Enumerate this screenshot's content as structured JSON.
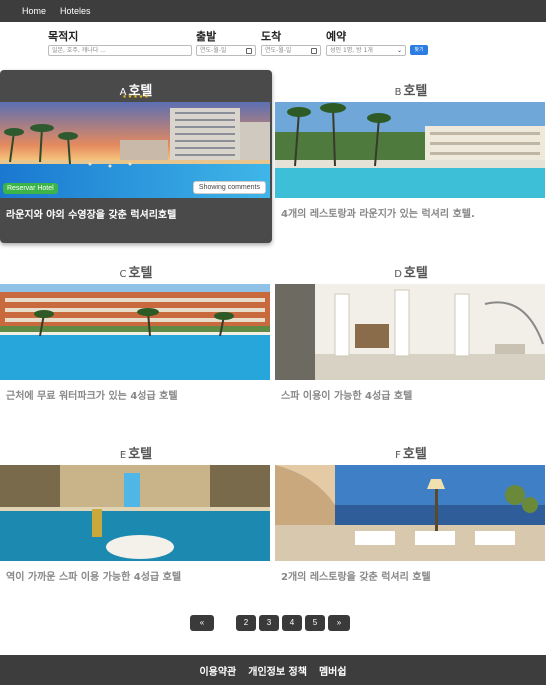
{
  "nav": {
    "items": [
      "Home",
      "Hoteles"
    ]
  },
  "search": {
    "destination_label": "목적지",
    "destination_placeholder": "일본, 호주, 캐나다 ...",
    "checkin_label": "출발",
    "checkin_value": "연도-월-일",
    "checkout_label": "도착",
    "checkout_value": "연도-월-일",
    "booking_label": "예약",
    "booking_value": "성인 1명, 방 1개",
    "search_button": "찾기"
  },
  "hotels": [
    {
      "letter": "A",
      "name": "호텔",
      "stars": "★★★★★",
      "desc": "라운지와 야외 수영장을 갖춘 럭셔리호텔",
      "reserve_badge": "Reservar Hotel",
      "comments_badge": "Showing comments"
    },
    {
      "letter": "B",
      "name": "호텔",
      "desc": "4개의 레스토랑과 라운지가 있는 럭셔리 호텔."
    },
    {
      "letter": "C",
      "name": "호텔",
      "desc": "근처에 무료 워터파크가 있는 4성급 호텔"
    },
    {
      "letter": "D",
      "name": "호텔",
      "desc": "스파 이용이 가능한 4성급 호텔"
    },
    {
      "letter": "E",
      "name": "호텔",
      "desc": "역이 가까운 스파 이용 가능한 4성급 호텔"
    },
    {
      "letter": "F",
      "name": "호텔",
      "desc": "2개의 레스토랑을 갖춘 럭셔리 호텔"
    }
  ],
  "pagination": {
    "prev": "«",
    "pages": [
      "2",
      "3",
      "4",
      "5"
    ],
    "next": "»"
  },
  "footer": {
    "links": [
      "이용약관",
      "개인정보 정책",
      "멤버쉽"
    ]
  },
  "colors": {
    "nav_bg": "#3d3d3d",
    "highlight_card": "#4a4a4a",
    "reserve_badge": "#3cb449",
    "search_button": "#2b7de1",
    "stars": "#f3c417"
  }
}
